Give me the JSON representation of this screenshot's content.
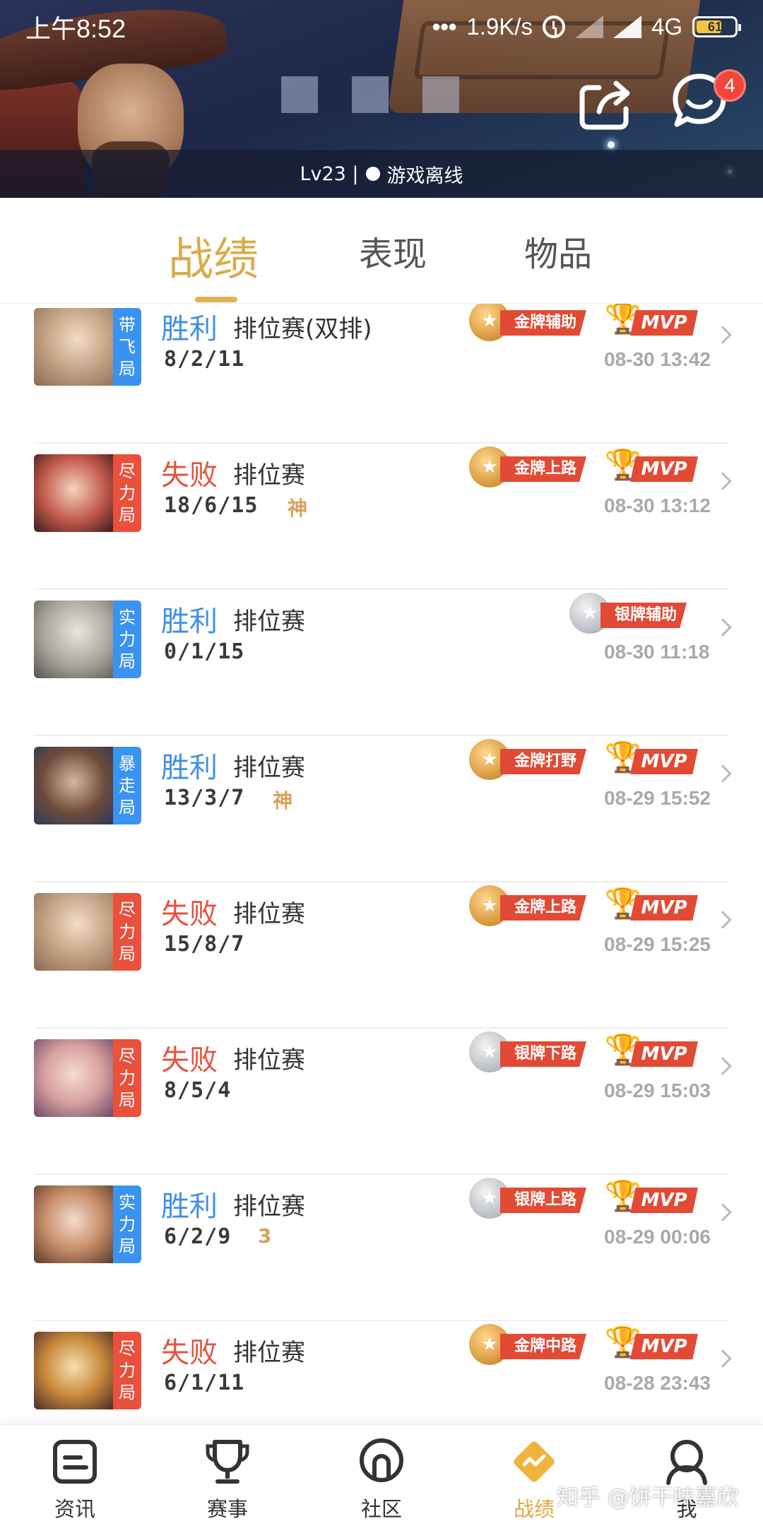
{
  "status_bar": {
    "time": "上午8:52",
    "net_speed": "1.9K/s",
    "network": "4G",
    "battery": "61"
  },
  "profile": {
    "level_text": "Lv23 |",
    "status_text": "游戏离线",
    "message_badge": "4"
  },
  "tabs": [
    {
      "label": "战绩"
    },
    {
      "label": "表现"
    },
    {
      "label": "物品"
    }
  ],
  "matches": [
    {
      "mode_tag": [
        "带",
        "飞",
        "局"
      ],
      "tag_color": "#3a93f0",
      "result": "胜利",
      "result_type": "win",
      "mode": "排位赛(双排)",
      "kda": "8/2/11",
      "god_text": "",
      "medal": "金牌辅助",
      "medal_tier": "gold",
      "mvp": true,
      "time": "08-30 13:42"
    },
    {
      "mode_tag": [
        "尽",
        "力",
        "局"
      ],
      "tag_color": "#ea503c",
      "result": "失败",
      "result_type": "lose",
      "mode": "排位赛",
      "kda": "18/6/15",
      "god_text": "神",
      "medal": "金牌上路",
      "medal_tier": "gold",
      "mvp": true,
      "time": "08-30 13:12"
    },
    {
      "mode_tag": [
        "实",
        "力",
        "局"
      ],
      "tag_color": "#3a93f0",
      "result": "胜利",
      "result_type": "win",
      "mode": "排位赛",
      "kda": "0/1/15",
      "god_text": "",
      "medal": "银牌辅助",
      "medal_tier": "silver",
      "mvp": false,
      "time": "08-30 11:18"
    },
    {
      "mode_tag": [
        "暴",
        "走",
        "局"
      ],
      "tag_color": "#3a93f0",
      "result": "胜利",
      "result_type": "win",
      "mode": "排位赛",
      "kda": "13/3/7",
      "god_text": "神",
      "medal": "金牌打野",
      "medal_tier": "gold",
      "mvp": true,
      "time": "08-29 15:52"
    },
    {
      "mode_tag": [
        "尽",
        "力",
        "局"
      ],
      "tag_color": "#ea503c",
      "result": "失败",
      "result_type": "lose",
      "mode": "排位赛",
      "kda": "15/8/7",
      "god_text": "",
      "medal": "金牌上路",
      "medal_tier": "gold",
      "mvp": true,
      "time": "08-29 15:25"
    },
    {
      "mode_tag": [
        "尽",
        "力",
        "局"
      ],
      "tag_color": "#ea503c",
      "result": "失败",
      "result_type": "lose",
      "mode": "排位赛",
      "kda": "8/5/4",
      "god_text": "",
      "medal": "银牌下路",
      "medal_tier": "silver",
      "mvp": true,
      "time": "08-29 15:03"
    },
    {
      "mode_tag": [
        "实",
        "力",
        "局"
      ],
      "tag_color": "#3a93f0",
      "result": "胜利",
      "result_type": "win",
      "mode": "排位赛",
      "kda": "6/2/9",
      "god_text": "3",
      "medal": "银牌上路",
      "medal_tier": "silver",
      "mvp": true,
      "time": "08-29 00:06"
    },
    {
      "mode_tag": [
        "尽",
        "力",
        "局"
      ],
      "tag_color": "#ea503c",
      "result": "失败",
      "result_type": "lose",
      "mode": "排位赛",
      "kda": "6/1/11",
      "god_text": "",
      "medal": "金牌中路",
      "medal_tier": "gold",
      "mvp": true,
      "time": "08-28 23:43"
    }
  ],
  "mvp_label": "MVP",
  "bottom_nav": [
    {
      "label": "资讯"
    },
    {
      "label": "赛事"
    },
    {
      "label": "社区"
    },
    {
      "label": "战绩"
    },
    {
      "label": "我"
    }
  ],
  "watermark": "知乎 @饼干味嘉欣",
  "colors": {
    "accent": "#e0a93e",
    "win": "#3e8fe8",
    "lose": "#e5533d",
    "medal_red": "#e24a35"
  }
}
